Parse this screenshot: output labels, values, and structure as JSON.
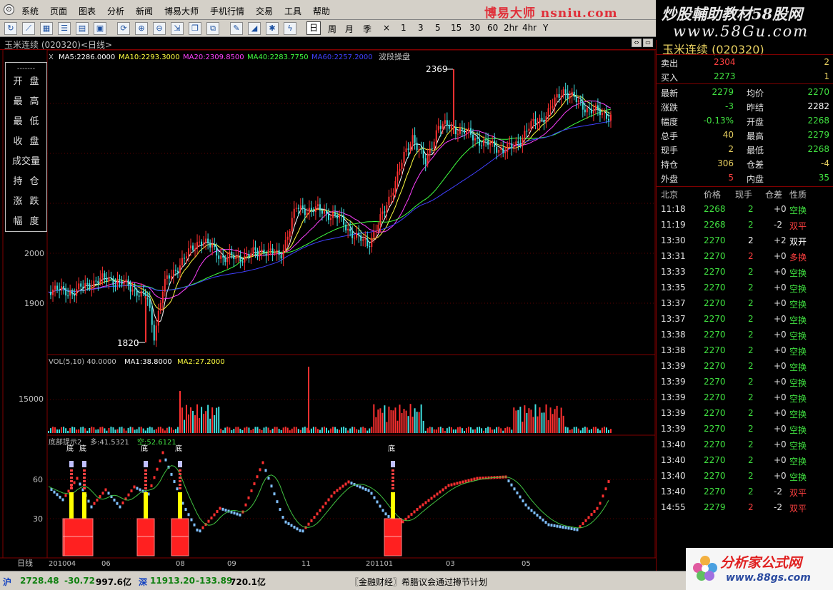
{
  "menu": {
    "items": [
      "系统",
      "页面",
      "图表",
      "分析",
      "新闻",
      "博易大师",
      "手机行情",
      "交易",
      "工具",
      "帮助"
    ],
    "brand": "博易大师 nsniu.com"
  },
  "toolbar": {
    "periods": [
      "日",
      "周",
      "月",
      "季",
      "×",
      "1",
      "3",
      "5",
      "15",
      "30",
      "60",
      "2hr",
      "4hr",
      "Y"
    ],
    "active_period": "日",
    "icons": [
      "refresh-icon",
      "line-chart-icon",
      "grid-icon",
      "list-icon",
      "table-icon",
      "f10-icon",
      "cycle-icon",
      "zoom-in-icon",
      "zoom-out-icon",
      "export-icon",
      "window-icon",
      "pen-icon",
      "draw-icon",
      "settings-icon",
      "lightning-icon"
    ]
  },
  "watermark_top": {
    "title": "炒股輔助教材58股网",
    "url": "www.58Gu.com"
  },
  "chart_title": "玉米连续 (020320)<日线>",
  "ohlc_panel": {
    "dash": "-------",
    "labels": [
      "开盘",
      "最高",
      "最低",
      "收盘",
      "成交量",
      "持仓",
      "涨跌",
      "幅度"
    ]
  },
  "main_chart": {
    "legend": {
      "prefix": "X",
      "ma5": "MA5:2286.0000",
      "ma10": "MA10:2293.3000",
      "ma20": "MA20:2309.8500",
      "ma40": "MA40:2283.7750",
      "ma60": "MA60:2257.2000",
      "extra": "波段操盘"
    },
    "high_label": "2369",
    "low_label": "1820",
    "y_ticks": [
      "2000",
      "1900"
    ]
  },
  "volume_chart": {
    "legend": {
      "vol": "VOL(5,10) 40.0000",
      "ma1": "MA1:38.8000",
      "ma2": "MA2:27.2000"
    },
    "y_ticks": [
      "15000"
    ]
  },
  "indicator_chart": {
    "legend": {
      "name": "底部提示2",
      "long": "多:41.5321",
      "short": "空:52.6121"
    },
    "signal_label": "底",
    "y_ticks": [
      "60",
      "30"
    ]
  },
  "x_axis": {
    "period_label": "日线",
    "labels": [
      "201004",
      "06",
      "08",
      "09",
      "11",
      "201101",
      "03",
      "05"
    ]
  },
  "chart_data": {
    "type": "candlestick",
    "symbol": "玉米连续 (020320)",
    "period": "日线",
    "series_ma": [
      "MA5",
      "MA10",
      "MA20",
      "MA40",
      "MA60"
    ],
    "annotated_high": 2369,
    "annotated_low": 1820,
    "y_ticks": [
      1900,
      2000
    ],
    "volume_y_ticks": [
      15000
    ],
    "indicator_y_ticks": [
      30,
      60
    ]
  },
  "quote": {
    "name": "玉米连续 (020320)",
    "ask": {
      "label": "卖出",
      "price": "2304",
      "qty": "2"
    },
    "bid": {
      "label": "买入",
      "price": "2273",
      "qty": "1"
    },
    "rows": [
      {
        "l1": "最新",
        "v1": "2279",
        "c1": "#40e040",
        "l2": "均价",
        "v2": "2270",
        "c2": "#40e040"
      },
      {
        "l1": "涨跌",
        "v1": "-3",
        "c1": "#40e040",
        "l2": "昨结",
        "v2": "2282",
        "c2": "#ffffff"
      },
      {
        "l1": "幅度",
        "v1": "-0.13%",
        "c1": "#40e040",
        "l2": "开盘",
        "v2": "2268",
        "c2": "#40e040"
      },
      {
        "l1": "总手",
        "v1": "40",
        "c1": "#e8d060",
        "l2": "最高",
        "v2": "2279",
        "c2": "#40e040"
      },
      {
        "l1": "现手",
        "v1": "2",
        "c1": "#e8d060",
        "l2": "最低",
        "v2": "2268",
        "c2": "#40e040"
      },
      {
        "l1": "持仓",
        "v1": "306",
        "c1": "#e8d060",
        "l2": "仓差",
        "v2": "-4",
        "c2": "#e8d060"
      },
      {
        "l1": "外盘",
        "v1": "5",
        "c1": "#ff4040",
        "l2": "内盘",
        "v2": "35",
        "c2": "#40e040"
      }
    ]
  },
  "ticks": {
    "headers": [
      "北京",
      "价格",
      "现手",
      "仓差",
      "性质"
    ],
    "rows": [
      {
        "time": "11:18",
        "price": "2268",
        "qty": "2",
        "qc": "#40e040",
        "diff": "+0",
        "nature": "空换",
        "nc": "#40e040"
      },
      {
        "time": "11:19",
        "price": "2268",
        "qty": "2",
        "qc": "#40e040",
        "diff": "-2",
        "nature": "双平",
        "nc": "#ff4040"
      },
      {
        "time": "13:30",
        "price": "2270",
        "qty": "2",
        "qc": "#ffffff",
        "diff": "+2",
        "nature": "双开",
        "nc": "#ffffff"
      },
      {
        "time": "13:31",
        "price": "2270",
        "qty": "2",
        "qc": "#ff4040",
        "diff": "+0",
        "nature": "多换",
        "nc": "#ff4040"
      },
      {
        "time": "13:33",
        "price": "2270",
        "qty": "2",
        "qc": "#40e040",
        "diff": "+0",
        "nature": "空换",
        "nc": "#40e040"
      },
      {
        "time": "13:35",
        "price": "2270",
        "qty": "2",
        "qc": "#40e040",
        "diff": "+0",
        "nature": "空换",
        "nc": "#40e040"
      },
      {
        "time": "13:37",
        "price": "2270",
        "qty": "2",
        "qc": "#40e040",
        "diff": "+0",
        "nature": "空换",
        "nc": "#40e040"
      },
      {
        "time": "13:37",
        "price": "2270",
        "qty": "2",
        "qc": "#40e040",
        "diff": "+0",
        "nature": "空换",
        "nc": "#40e040"
      },
      {
        "time": "13:38",
        "price": "2270",
        "qty": "2",
        "qc": "#40e040",
        "diff": "+0",
        "nature": "空换",
        "nc": "#40e040"
      },
      {
        "time": "13:38",
        "price": "2270",
        "qty": "2",
        "qc": "#40e040",
        "diff": "+0",
        "nature": "空换",
        "nc": "#40e040"
      },
      {
        "time": "13:39",
        "price": "2270",
        "qty": "2",
        "qc": "#40e040",
        "diff": "+0",
        "nature": "空换",
        "nc": "#40e040"
      },
      {
        "time": "13:39",
        "price": "2270",
        "qty": "2",
        "qc": "#40e040",
        "diff": "+0",
        "nature": "空换",
        "nc": "#40e040"
      },
      {
        "time": "13:39",
        "price": "2270",
        "qty": "2",
        "qc": "#40e040",
        "diff": "+0",
        "nature": "空换",
        "nc": "#40e040"
      },
      {
        "time": "13:39",
        "price": "2270",
        "qty": "2",
        "qc": "#40e040",
        "diff": "+0",
        "nature": "空换",
        "nc": "#40e040"
      },
      {
        "time": "13:39",
        "price": "2270",
        "qty": "2",
        "qc": "#40e040",
        "diff": "+0",
        "nature": "空换",
        "nc": "#40e040"
      },
      {
        "time": "13:40",
        "price": "2270",
        "qty": "2",
        "qc": "#40e040",
        "diff": "+0",
        "nature": "空换",
        "nc": "#40e040"
      },
      {
        "time": "13:40",
        "price": "2270",
        "qty": "2",
        "qc": "#40e040",
        "diff": "+0",
        "nature": "空换",
        "nc": "#40e040"
      },
      {
        "time": "13:40",
        "price": "2270",
        "qty": "2",
        "qc": "#40e040",
        "diff": "+0",
        "nature": "空换",
        "nc": "#40e040"
      },
      {
        "time": "13:40",
        "price": "2270",
        "qty": "2",
        "qc": "#40e040",
        "diff": "-2",
        "nature": "双平",
        "nc": "#ff4040"
      },
      {
        "time": "14:55",
        "price": "2279",
        "qty": "2",
        "qc": "#ff4040",
        "diff": "-2",
        "nature": "双平",
        "nc": "#ff4040"
      }
    ]
  },
  "watermark_bottom": {
    "title": "分析家公式网",
    "url": "www.88gs.com"
  },
  "statusbar": {
    "sh_label": "沪",
    "sh_index": "2728.48",
    "sh_change": "-30.72",
    "sh_amount": "997.6亿",
    "sz_label": "深",
    "sz_index": "11913.20",
    "sz_change": "-133.89",
    "sz_amount": "720.1亿",
    "news": "〖金融财经〗希腊议会通过撙节计划"
  },
  "colors": {
    "up": "#ff3030",
    "down": "#40e0e0",
    "ma5": "#ffffff",
    "ma10": "#ffff40",
    "ma20": "#ff40ff",
    "ma40": "#40ff40",
    "ma60": "#4040ff",
    "grid": "#800000"
  }
}
